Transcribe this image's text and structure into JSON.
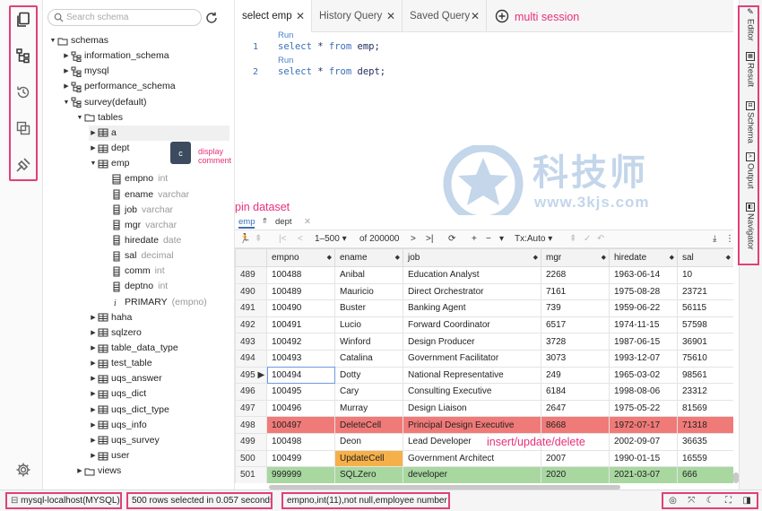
{
  "sidebar_icons": [
    "document-copy-icon",
    "schema-tree-icon",
    "history-icon",
    "copy-panels-icon",
    "plugin-icon"
  ],
  "settings_icon": "gear-icon",
  "search": {
    "placeholder": "Search schema"
  },
  "tree": [
    {
      "label": "schemas",
      "type": "",
      "depth": 0,
      "caret": "▼",
      "icon": "folder"
    },
    {
      "label": "information_schema",
      "type": "",
      "depth": 1,
      "caret": "▶",
      "icon": "schema"
    },
    {
      "label": "mysql",
      "type": "",
      "depth": 1,
      "caret": "▶",
      "icon": "schema"
    },
    {
      "label": "performance_schema",
      "type": "",
      "depth": 1,
      "caret": "▶",
      "icon": "schema"
    },
    {
      "label": "survey(default)",
      "type": "",
      "depth": 1,
      "caret": "▼",
      "icon": "schema"
    },
    {
      "label": "tables",
      "type": "",
      "depth": 2,
      "caret": "▼",
      "icon": "folder"
    },
    {
      "label": "a",
      "type": "",
      "depth": 3,
      "caret": "▶",
      "icon": "table",
      "selected": true
    },
    {
      "label": "dept",
      "type": "",
      "depth": 3,
      "caret": "▶",
      "icon": "table"
    },
    {
      "label": "emp",
      "type": "",
      "depth": 3,
      "caret": "▼",
      "icon": "table"
    },
    {
      "label": "empno",
      "type": "int",
      "depth": 4,
      "caret": "",
      "icon": "key"
    },
    {
      "label": "ename",
      "type": "varchar",
      "depth": 4,
      "caret": "",
      "icon": "column"
    },
    {
      "label": "job",
      "type": "varchar",
      "depth": 4,
      "caret": "",
      "icon": "column"
    },
    {
      "label": "mgr",
      "type": "varchar",
      "depth": 4,
      "caret": "",
      "icon": "column"
    },
    {
      "label": "hiredate",
      "type": "date",
      "depth": 4,
      "caret": "",
      "icon": "column"
    },
    {
      "label": "sal",
      "type": "decimal",
      "depth": 4,
      "caret": "",
      "icon": "column"
    },
    {
      "label": "comm",
      "type": "int",
      "depth": 4,
      "caret": "",
      "icon": "column"
    },
    {
      "label": "deptno",
      "type": "int",
      "depth": 4,
      "caret": "",
      "icon": "column"
    },
    {
      "label": "PRIMARY",
      "type": "(empno)",
      "depth": 4,
      "caret": "",
      "icon": "index"
    },
    {
      "label": "haha",
      "type": "",
      "depth": 3,
      "caret": "▶",
      "icon": "table"
    },
    {
      "label": "sqlzero",
      "type": "",
      "depth": 3,
      "caret": "▶",
      "icon": "table"
    },
    {
      "label": "table_data_type",
      "type": "",
      "depth": 3,
      "caret": "▶",
      "icon": "table"
    },
    {
      "label": "test_table",
      "type": "",
      "depth": 3,
      "caret": "▶",
      "icon": "table"
    },
    {
      "label": "uqs_answer",
      "type": "",
      "depth": 3,
      "caret": "▶",
      "icon": "table"
    },
    {
      "label": "uqs_dict",
      "type": "",
      "depth": 3,
      "caret": "▶",
      "icon": "table"
    },
    {
      "label": "uqs_dict_type",
      "type": "",
      "depth": 3,
      "caret": "▶",
      "icon": "table"
    },
    {
      "label": "uqs_info",
      "type": "",
      "depth": 3,
      "caret": "▶",
      "icon": "table"
    },
    {
      "label": "uqs_survey",
      "type": "",
      "depth": 3,
      "caret": "▶",
      "icon": "table"
    },
    {
      "label": "user",
      "type": "",
      "depth": 3,
      "caret": "▶",
      "icon": "table"
    },
    {
      "label": "views",
      "type": "",
      "depth": 2,
      "caret": "▶",
      "icon": "folder"
    }
  ],
  "tooltip": {
    "text": "c",
    "note": "display comment"
  },
  "tabs": [
    {
      "label": "select emp",
      "close": "✕",
      "active": true
    },
    {
      "label": "History Query",
      "close": "✕",
      "active": false
    },
    {
      "label": "Saved Query",
      "close": "✕",
      "active": false
    }
  ],
  "multi_session_label": "multi session",
  "editor": {
    "run_label": "Run",
    "lines": [
      {
        "num": "1",
        "kw1": "select",
        "mid": " * ",
        "kw2": "from",
        "rest": " emp;"
      },
      {
        "num": "2",
        "kw1": "select",
        "mid": " * ",
        "kw2": "from",
        "rest": " dept;"
      }
    ]
  },
  "watermark": {
    "cn": "科技师",
    "url": "www.3kjs.com"
  },
  "pin_label": "pin dataset",
  "dataset_tabs": {
    "a": "emp",
    "pin": "⇑",
    "b": "dept",
    "close": "✕"
  },
  "toolbar": {
    "range": "1–500 ▾",
    "of": "of 200000",
    "tx": "Tx:Auto ▾"
  },
  "grid": {
    "columns": [
      "empno",
      "ename",
      "job",
      "mgr",
      "hiredate",
      "sal"
    ],
    "rows": [
      {
        "n": "489",
        "cells": [
          "100488",
          "Anibal",
          "Education Analyst",
          "2268",
          "1963-06-14",
          "10"
        ],
        "state": ""
      },
      {
        "n": "490",
        "cells": [
          "100489",
          "Mauricio",
          "Direct Orchestrator",
          "7161",
          "1975-08-28",
          "23721"
        ],
        "state": ""
      },
      {
        "n": "491",
        "cells": [
          "100490",
          "Buster",
          "Banking Agent",
          "739",
          "1959-06-22",
          "56115"
        ],
        "state": ""
      },
      {
        "n": "492",
        "cells": [
          "100491",
          "Lucio",
          "Forward Coordinator",
          "6517",
          "1974-11-15",
          "57598"
        ],
        "state": ""
      },
      {
        "n": "493",
        "cells": [
          "100492",
          "Winford",
          "Design Producer",
          "3728",
          "1987-06-15",
          "36901"
        ],
        "state": ""
      },
      {
        "n": "494",
        "cells": [
          "100493",
          "Catalina",
          "Government Facilitator",
          "3073",
          "1993-12-07",
          "75610"
        ],
        "state": ""
      },
      {
        "n": "495 ▶",
        "cells": [
          "100494",
          "Dotty",
          "National Representative",
          "249",
          "1965-03-02",
          "98561"
        ],
        "state": "cur"
      },
      {
        "n": "496",
        "cells": [
          "100495",
          "Cary",
          "Consulting Executive",
          "6184",
          "1998-08-06",
          "23312"
        ],
        "state": ""
      },
      {
        "n": "497",
        "cells": [
          "100496",
          "Murray",
          "Design Liaison",
          "2647",
          "1975-05-22",
          "81569"
        ],
        "state": ""
      },
      {
        "n": "498",
        "cells": [
          "100497",
          "DeleteCell",
          "Principal Design Executive",
          "8668",
          "1972-07-17",
          "71318"
        ],
        "state": "del"
      },
      {
        "n": "499",
        "cells": [
          "100498",
          "Deon",
          "Lead Developer",
          "",
          "2002-09-07",
          "36635"
        ],
        "state": ""
      },
      {
        "n": "500",
        "cells": [
          "100499",
          "UpdateCell",
          "Government Architect",
          "2007",
          "1990-01-15",
          "16559"
        ],
        "state": "upd"
      },
      {
        "n": "501",
        "cells": [
          "999999",
          "SQLZero",
          "developer",
          "2020",
          "2021-03-07",
          "666"
        ],
        "state": "ins"
      }
    ]
  },
  "iud_label": "insert/update/delete",
  "right_tabs": [
    "Editor",
    "Result",
    "Schema",
    "Output",
    "Navigator"
  ],
  "status": {
    "connection": "mysql-localhost(MYSQL)",
    "rows_info": "500 rows selected in 0.057 seconds",
    "column_info": "empno,int(11),not null,employee number"
  }
}
